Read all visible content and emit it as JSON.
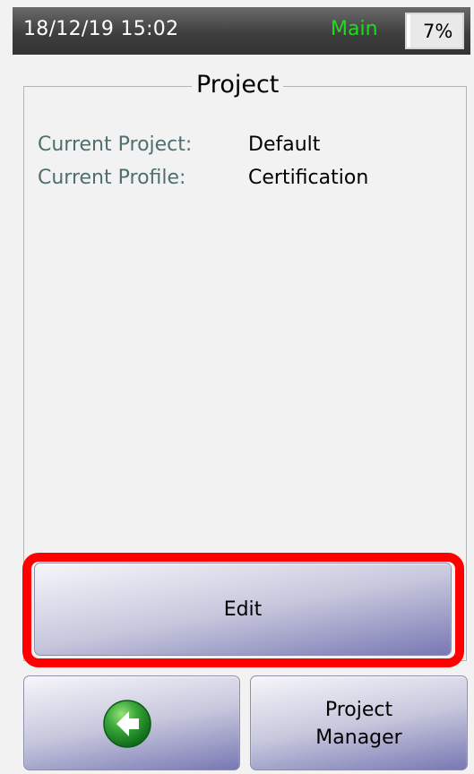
{
  "status_bar": {
    "datetime": "18/12/19 15:02",
    "mode": "Main",
    "battery": "7%",
    "battery_level": 0.07
  },
  "panel": {
    "title": "Project",
    "rows": [
      {
        "label": "Current Project:",
        "value": "Default"
      },
      {
        "label": "Current Profile:",
        "value": "Certification"
      }
    ]
  },
  "buttons": {
    "edit": "Edit",
    "project_manager_line1": "Project",
    "project_manager_line2": "Manager",
    "back_icon": "back-arrow-icon"
  },
  "colors": {
    "mode_text": "#1fdc1f",
    "highlight": "#ff0000",
    "label_text": "#4f6f6f"
  }
}
